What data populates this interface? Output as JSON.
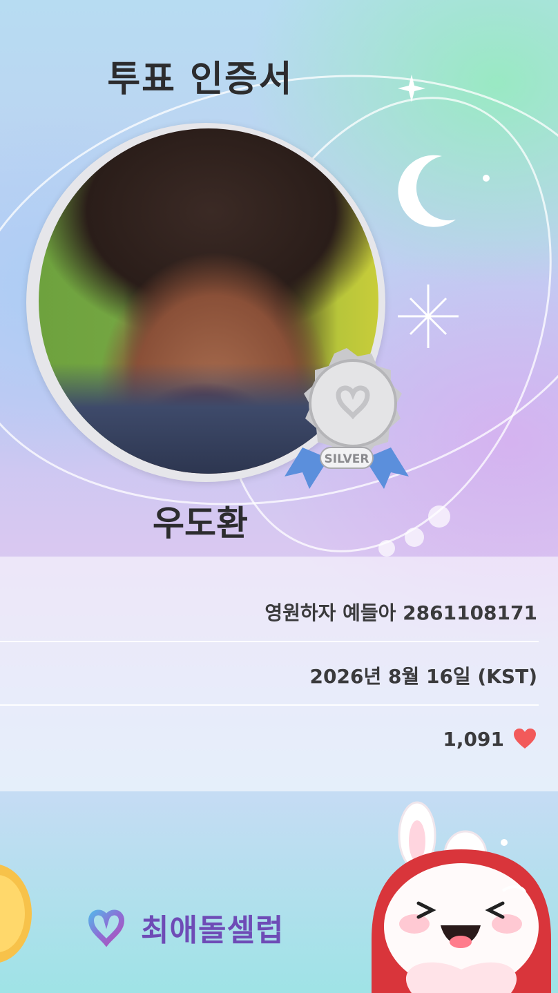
{
  "certificate": {
    "title": "투표 인증서",
    "name": "우도환",
    "badge_label": "SILVER"
  },
  "details": {
    "vote_event": "영원하자 예들아 2861108171",
    "date": "2026년 8월 16일 (KST)",
    "vote_count": "1,091"
  },
  "brand": {
    "logo_text": "최애돌셀럽"
  },
  "colors": {
    "heart": "#f25a5a",
    "brand_purple": "#6e4bb6",
    "silver": "#c9c9cc",
    "ribbon": "#5b8fdc"
  },
  "icons": [
    "heart-icon",
    "moon-icon",
    "sparkle-icon",
    "medal-icon",
    "logo-heart-icon",
    "rabbit-mascot"
  ]
}
